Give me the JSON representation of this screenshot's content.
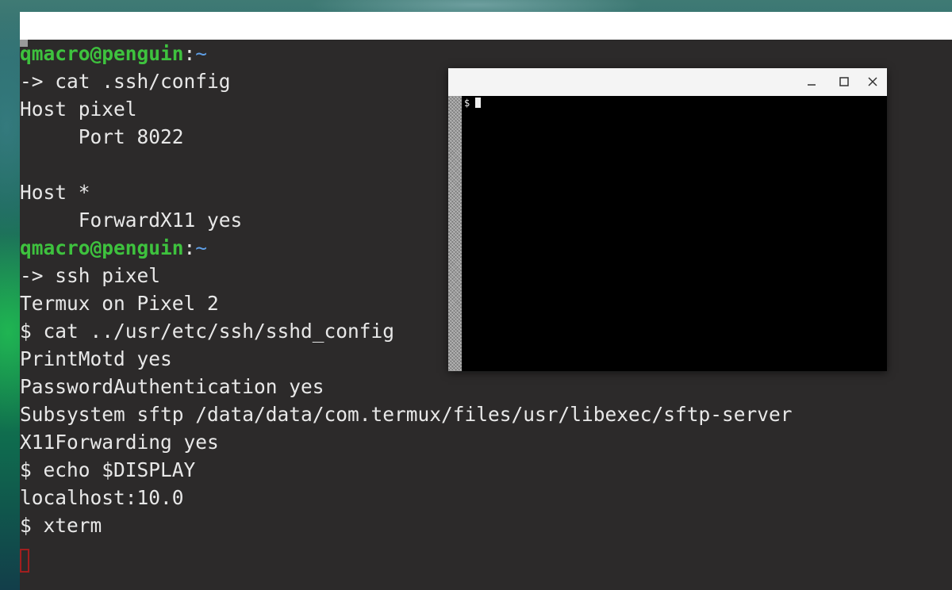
{
  "terminal": {
    "lines": [
      {
        "user": "qmacro@penguin",
        "colon": ":",
        "path": "~"
      },
      {
        "text": "-> cat .ssh/config"
      },
      {
        "text": "Host pixel"
      },
      {
        "text": "     Port 8022"
      },
      {
        "text": ""
      },
      {
        "text": "Host *"
      },
      {
        "text": "     ForwardX11 yes"
      },
      {
        "user": "qmacro@penguin",
        "colon": ":",
        "path": "~"
      },
      {
        "text": "-> ssh pixel"
      },
      {
        "text": "Termux on Pixel 2"
      },
      {
        "text": "$ cat ../usr/etc/ssh/sshd_config"
      },
      {
        "text": "PrintMotd yes"
      },
      {
        "text": "PasswordAuthentication yes"
      },
      {
        "text": "Subsystem sftp /data/data/com.termux/files/usr/libexec/sftp-server"
      },
      {
        "text": "X11Forwarding yes"
      },
      {
        "text": "$ echo $DISPLAY"
      },
      {
        "text": "localhost:10.0"
      },
      {
        "text": "$ xterm"
      }
    ],
    "colors": {
      "background": "#2c2a2a",
      "text": "#e8e8e8",
      "prompt_user": "#3ec23e",
      "prompt_path": "#5fa0e8",
      "cursor_outline": "#a11f1f"
    }
  },
  "xterm": {
    "prompt": "$",
    "buttons": {
      "minimize": "minimize-icon",
      "maximize": "maximize-icon",
      "close": "close-icon"
    },
    "colors": {
      "screen": "#000000",
      "titlebar": "#f4f4f4"
    }
  }
}
